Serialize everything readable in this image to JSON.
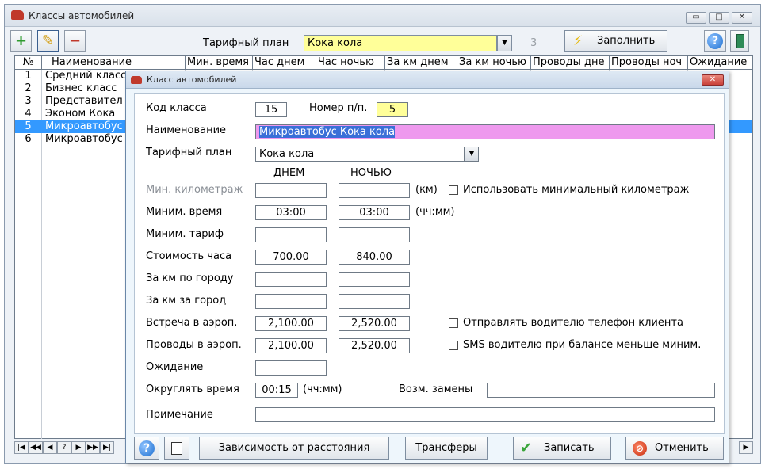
{
  "window": {
    "title": "Классы автомобилей",
    "min": "▭",
    "max": "□",
    "close": "✕"
  },
  "toolbar": {
    "tarif_label": "Тарифный план",
    "tarif_value": "Кока кола",
    "tarif_count": "3",
    "fill_label": "Заполнить",
    "add_glyph": "+",
    "edit_glyph": "✎",
    "delete_glyph": "−",
    "help_glyph": "?"
  },
  "grid": {
    "headers": [
      "№",
      "Наименование",
      "Мин. время",
      "Час днем",
      "Час ночью",
      "За км днем",
      "За км ночью",
      "Проводы дне",
      "Проводы ноч",
      "Ожидание"
    ],
    "rows": [
      {
        "num": "1",
        "name": "Средний класс"
      },
      {
        "num": "2",
        "name": "Бизнес класс"
      },
      {
        "num": "3",
        "name": "Представител"
      },
      {
        "num": "4",
        "name": "Эконом Кока"
      },
      {
        "num": "5",
        "name": "Микроавтобус"
      },
      {
        "num": "6",
        "name": "Микроавтобус"
      }
    ],
    "nav": [
      "|◀",
      "◀◀",
      "◀",
      "?",
      "▶",
      "▶▶",
      "▶|"
    ],
    "scroll_right": "▶"
  },
  "dialog": {
    "title": "Класс автомобилей",
    "close": "✕",
    "kod_label": "Код класса",
    "kod_value": "15",
    "nomer_label": "Номер п/п.",
    "nomer_value": "5",
    "name_label": "Наименование",
    "name_value": "Микроавтобус Кока кола",
    "tarif_label": "Тарифный план",
    "tarif_value": "Кока кола",
    "day_header": "ДНЕМ",
    "night_header": "НОЧЬЮ",
    "min_km_label": "Мин. километраж",
    "min_km_unit": "(км)",
    "min_km_check": "Использовать минимальный километраж",
    "min_time_label": "Миним. время",
    "min_time_day": "03:00",
    "min_time_night": "03:00",
    "min_time_unit": "(чч:мм)",
    "min_tarif_label": "Миним. тариф",
    "hour_cost_label": "Стоимость часа",
    "hour_cost_day": "700.00",
    "hour_cost_night": "840.00",
    "km_city_label": "За км по городу",
    "km_out_label": "За км за город",
    "meet_label": "Встреча в аэроп.",
    "meet_day": "2,100.00",
    "meet_night": "2,520.00",
    "send_phone_check": "Отправлять водителю телефон клиента",
    "see_label": "Проводы в аэроп.",
    "see_day": "2,100.00",
    "see_night": "2,520.00",
    "sms_check": "SMS водителю при балансе меньше миним.",
    "wait_label": "Ожидание",
    "round_label": "Округлять время",
    "round_value": "00:15",
    "round_unit": "(чч:мм)",
    "replace_label": "Возм. замены",
    "note_label": "Примечание",
    "btn_distance": "Зависимость от расстояния",
    "btn_transfers": "Трансферы",
    "btn_save": "Записать",
    "btn_cancel": "Отменить"
  }
}
